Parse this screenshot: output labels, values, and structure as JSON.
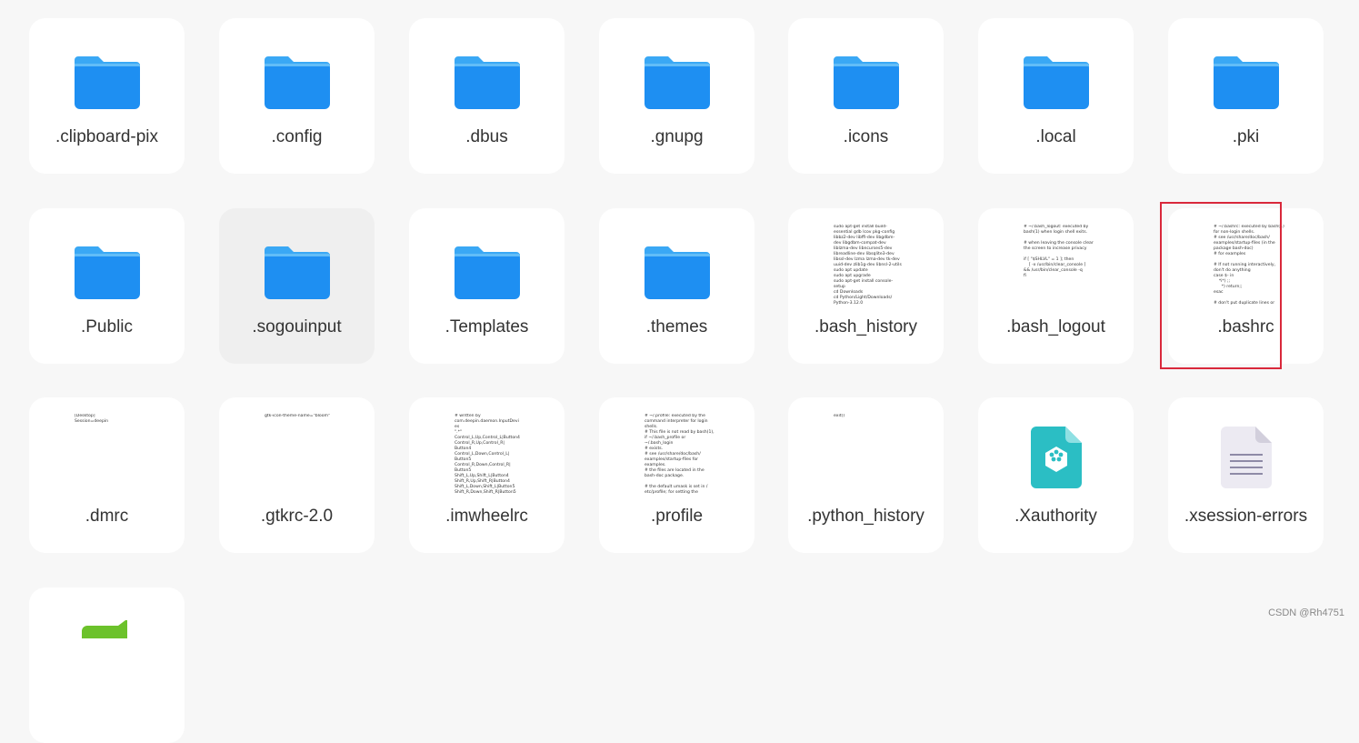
{
  "tiles": [
    {
      "name": ".clipboard-pix",
      "type": "folder"
    },
    {
      "name": ".config",
      "type": "folder"
    },
    {
      "name": ".dbus",
      "type": "folder"
    },
    {
      "name": ".gnupg",
      "type": "folder"
    },
    {
      "name": ".icons",
      "type": "folder"
    },
    {
      "name": ".local",
      "type": "folder"
    },
    {
      "name": ".pki",
      "type": "folder"
    },
    {
      "name": ".Public",
      "type": "folder"
    },
    {
      "name": ".sogouinput",
      "type": "folder"
    },
    {
      "name": ".Templates",
      "type": "folder"
    },
    {
      "name": ".themes",
      "type": "folder"
    },
    {
      "name": ".bash_history",
      "type": "text"
    },
    {
      "name": ".bash_logout",
      "type": "text"
    },
    {
      "name": ".bashrc",
      "type": "text"
    },
    {
      "name": ".dmrc",
      "type": "text"
    },
    {
      "name": ".gtkrc-2.0",
      "type": "text"
    },
    {
      "name": ".imwheelrc",
      "type": "text"
    },
    {
      "name": ".profile",
      "type": "text"
    },
    {
      "name": ".python_history",
      "type": "text"
    },
    {
      "name": ".Xauthority",
      "type": "xauth"
    },
    {
      "name": ".xsession-errors",
      "type": "document"
    }
  ],
  "previews": {
    "bash_history": "sudo apt-get install build-\nessential gdb lcov pkg-config\nlibbz2-dev libffi-dev libgdbm-\ndev libgdbm-compat-dev\nliblzma-dev libncurses5-dev\nlibreadline-dev libsqlite3-dev\nlibssl-dev lzma lzma-dev tk-dev\nuuid-dev zlib1g-dev libnsl-2-utils\nsudo apt update\nsudo apt upgrade\nsudo apt-get install console-\nsetup\ncd Downloads\ncd Python/Light/Downloads/\nPython-3.12.0",
    "bash_logout": "# ~/.bash_logout: executed by\nbash(1) when login shell exits.\n\n# when leaving the console clear\nthe screen to increase privacy\n\nif [ \"$SHLVL\" = 1 ]; then\n    [ -x /usr/bin/clear_console ]\n&& /usr/bin/clear_console -q\nfi",
    "bashrc": "# ~/.bashrc: executed by bash(1)\nfor non-login shells.\n# see /usr/share/doc/bash/\nexamples/startup-files (in the\npackage bash-doc)\n# for examples\n\n# If not running interactively,\ndon't do anything\ncase $- in\n    *i*) ;;\n      *) return;;\nesac\n\n# don't put duplicate lines or",
    "dmrc": "[Desktop]\nSession=deepin",
    "gtkrc": "gtk-icon-theme-name=\"bloom\"",
    "imwheelrc": "# written by\ncom.deepin.daemon.InputDevi\nes\n\".*\"\nControl_L,Up,Control_L|Button4\nControl_R,Up,Control_R|\nButton4\nControl_L,Down,Control_L|\nButton5\nControl_R,Down,Control_R|\nButton5\nShift_L,Up,Shift_L|Button4\nShift_R,Up,Shift_R|Button4\nShift_L,Down,Shift_L|Button5\nShift_R,Down,Shift_R|Button5",
    "profile": "# ~/.profile: executed by the\ncommand interpreter for login\nshells.\n# This file is not read by bash(1),\nif ~/.bash_profile or\n~/.bash_login\n# exists.\n# see /usr/share/doc/bash/\nexamples/startup-files for\nexamples.\n# the files are located in the\nbash-doc package.\n\n# the default umask is set in /\netc/profile; for setting the",
    "python_history": "exit()"
  },
  "watermark": "CSDN @Rh4751",
  "colors": {
    "folder_top": "#3aa8f5",
    "folder_body": "#1e8ff2",
    "selection": "#d9283b",
    "xauth": "#2bbec4"
  }
}
